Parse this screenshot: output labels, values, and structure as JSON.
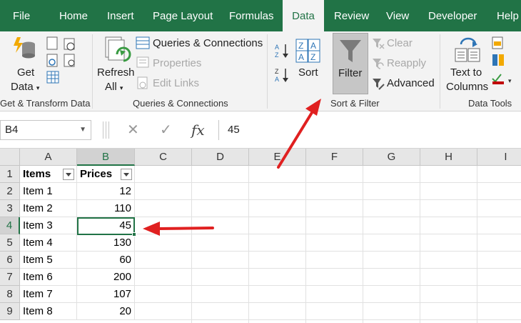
{
  "tabs": [
    "File",
    "Home",
    "Insert",
    "Page Layout",
    "Formulas",
    "Data",
    "Review",
    "View",
    "Developer",
    "Help"
  ],
  "active_tab": "Data",
  "ribbon": {
    "get_data_line1": "Get",
    "get_data_line2": "Data",
    "get_transform_label": "Get & Transform Data",
    "refresh_line1": "Refresh",
    "refresh_line2": "All",
    "queries_connections": "Queries & Connections",
    "properties": "Properties",
    "edit_links": "Edit Links",
    "queries_group_label": "Queries & Connections",
    "sort": "Sort",
    "filter": "Filter",
    "clear": "Clear",
    "reapply": "Reapply",
    "advanced": "Advanced",
    "sort_filter_label": "Sort & Filter",
    "text_to_line1": "Text to",
    "text_to_line2": "Columns",
    "data_tools_label": "Data Tools"
  },
  "formula_bar": {
    "name_box": "B4",
    "cancel_glyph": "✕",
    "enter_glyph": "✓",
    "fx_glyph": "fx",
    "content": "45"
  },
  "columns": [
    "A",
    "B",
    "C",
    "D",
    "E",
    "F",
    "G",
    "H",
    "I"
  ],
  "rows": [
    "1",
    "2",
    "3",
    "4",
    "5",
    "6",
    "7",
    "8",
    "9"
  ],
  "sheet": {
    "headers": [
      "Items",
      "Prices"
    ],
    "data": [
      [
        "Item 1",
        "12"
      ],
      [
        "Item 2",
        "110"
      ],
      [
        "Item 3",
        "45"
      ],
      [
        "Item 4",
        "130"
      ],
      [
        "Item 5",
        "60"
      ],
      [
        "Item 6",
        "200"
      ],
      [
        "Item 7",
        "107"
      ],
      [
        "Item 8",
        "20"
      ]
    ]
  },
  "colors": {
    "excel_green": "#217346",
    "annotation_arrow": "#e02020"
  }
}
